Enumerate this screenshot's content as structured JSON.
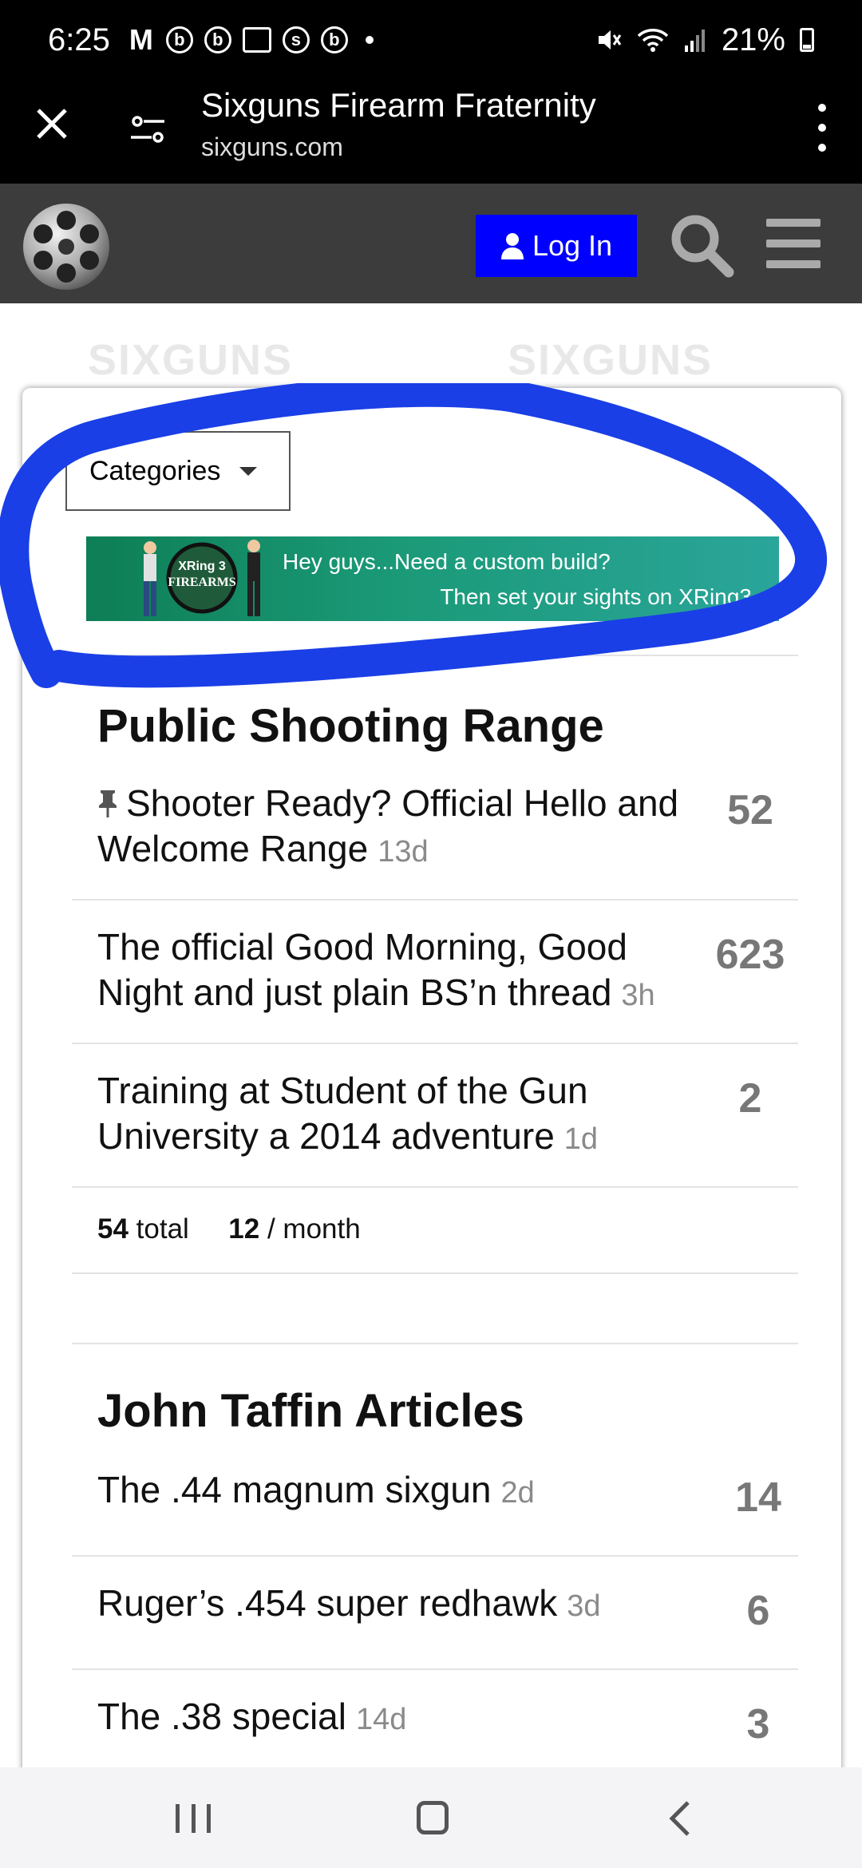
{
  "status_bar": {
    "time": "6:25",
    "battery": "21%",
    "notif_icons": [
      "M",
      "b",
      "b",
      "cal",
      "s",
      "b"
    ]
  },
  "browser": {
    "title": "Sixguns Firearm Fraternity",
    "url": "sixguns.com"
  },
  "header": {
    "login_label": "Log In"
  },
  "background_brand": [
    "SIXGUNS",
    "SIXGUNS"
  ],
  "categories": {
    "label": "Categories"
  },
  "banner": {
    "line1": "Hey guys...Need a custom build?",
    "line2": "Then set your sights on XRing3",
    "logo_text_1": "XRing 3",
    "logo_text_2": "FIREARMS"
  },
  "sections": [
    {
      "title": "Public Shooting Range",
      "topics": [
        {
          "title": "Shooter Ready? Official Hello and Welcome Range",
          "age": "13d",
          "replies": "52",
          "pinned": true
        },
        {
          "title": "The official Good Morning, Good Night and just plain BS’n thread",
          "age": "3h",
          "replies": "623"
        },
        {
          "title": "Training at Student of the Gun University a 2014 adventure",
          "age": "1d",
          "replies": "2"
        }
      ],
      "stats": {
        "total": "54",
        "total_label": "total",
        "monthly": "12",
        "monthly_label": "/ month"
      }
    },
    {
      "title": "John Taffin Articles",
      "topics": [
        {
          "title": "The .44 magnum sixgun",
          "age": "2d",
          "replies": "14"
        },
        {
          "title": "Ruger’s .454 super redhawk",
          "age": "3d",
          "replies": "6"
        },
        {
          "title": "The .38 special",
          "age": "14d",
          "replies": "3"
        }
      ]
    }
  ],
  "colors": {
    "accent": "#0000ff",
    "header_bg": "#3c3c3c",
    "highlight": "#1a3fe6",
    "banner": "#1b9a78"
  }
}
